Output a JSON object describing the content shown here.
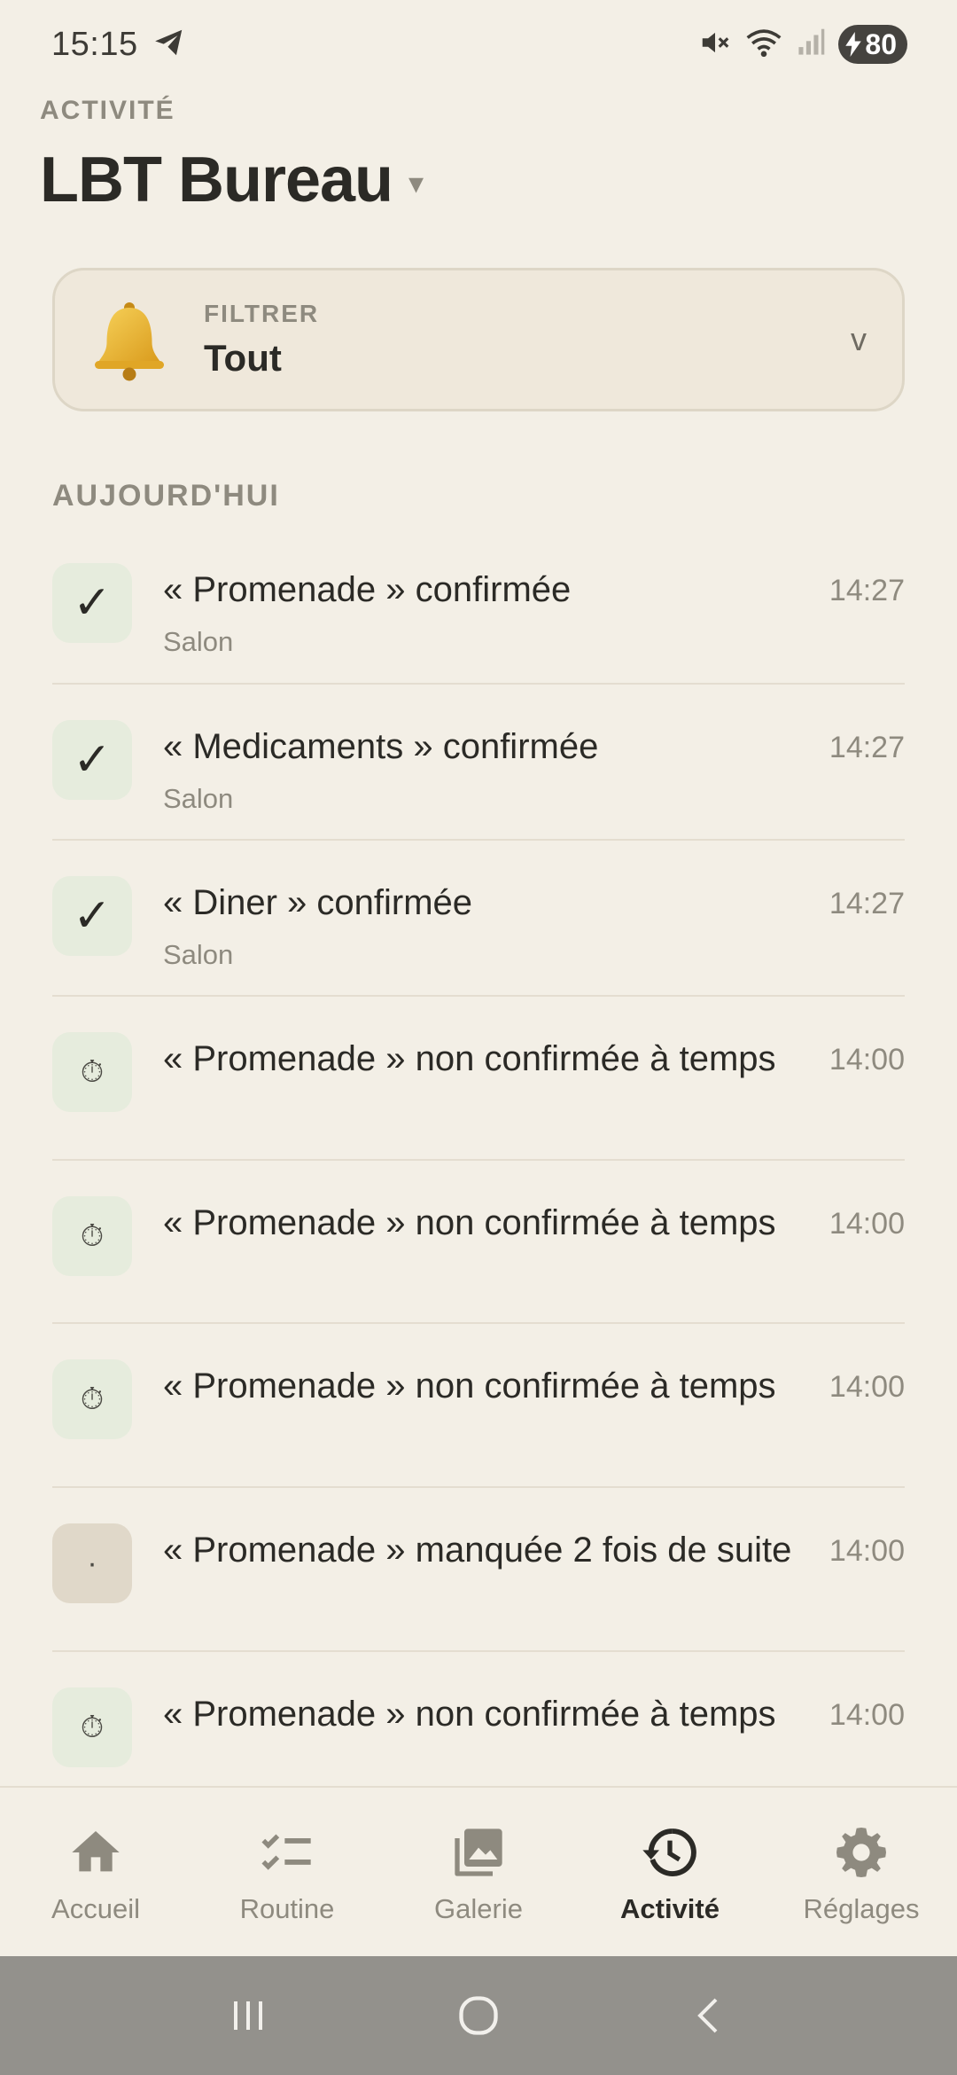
{
  "status_bar": {
    "time": "15:15",
    "battery": "80"
  },
  "header": {
    "eyebrow": "ACTIVITÉ",
    "title": "LBT Bureau",
    "caret": "▾"
  },
  "filter": {
    "label": "FILTRER",
    "value": "Tout",
    "chevron": "v",
    "icon": "bell-icon"
  },
  "section": {
    "title": "AUJOURD'HUI"
  },
  "items": [
    {
      "title": "« Promenade » confirmée",
      "sub": "Salon",
      "time": "14:27",
      "status": "ok",
      "icon": "✓"
    },
    {
      "title": "« Medicaments » confirmée",
      "sub": "Salon",
      "time": "14:27",
      "status": "ok",
      "icon": "✓"
    },
    {
      "title": "« Diner » confirmée",
      "sub": "Salon",
      "time": "14:27",
      "status": "ok",
      "icon": "✓"
    },
    {
      "title": "« Promenade » non confirmée à temps",
      "sub": "",
      "time": "14:00",
      "status": "late",
      "icon": "⏱"
    },
    {
      "title": "« Promenade » non confirmée à temps",
      "sub": "",
      "time": "14:00",
      "status": "late",
      "icon": "⏱"
    },
    {
      "title": "« Promenade » non confirmée à temps",
      "sub": "",
      "time": "14:00",
      "status": "late",
      "icon": "⏱"
    },
    {
      "title": "« Promenade » manquée 2 fois de suite",
      "sub": "",
      "time": "14:00",
      "status": "missed",
      "icon": "·"
    },
    {
      "title": "« Promenade » non confirmée à temps",
      "sub": "",
      "time": "14:00",
      "status": "late",
      "icon": "⏱"
    }
  ],
  "nav": {
    "home": "Accueil",
    "routine": "Routine",
    "gallery": "Galerie",
    "activity": "Activité",
    "settings": "Réglages"
  },
  "colors": {
    "background": "#f3efe6",
    "text": "#2b2a26",
    "muted": "#8e8a7f",
    "ok_badge": "#e6ecdd",
    "missed_badge": "#e0d8c9",
    "system_nav": "#93918c"
  }
}
